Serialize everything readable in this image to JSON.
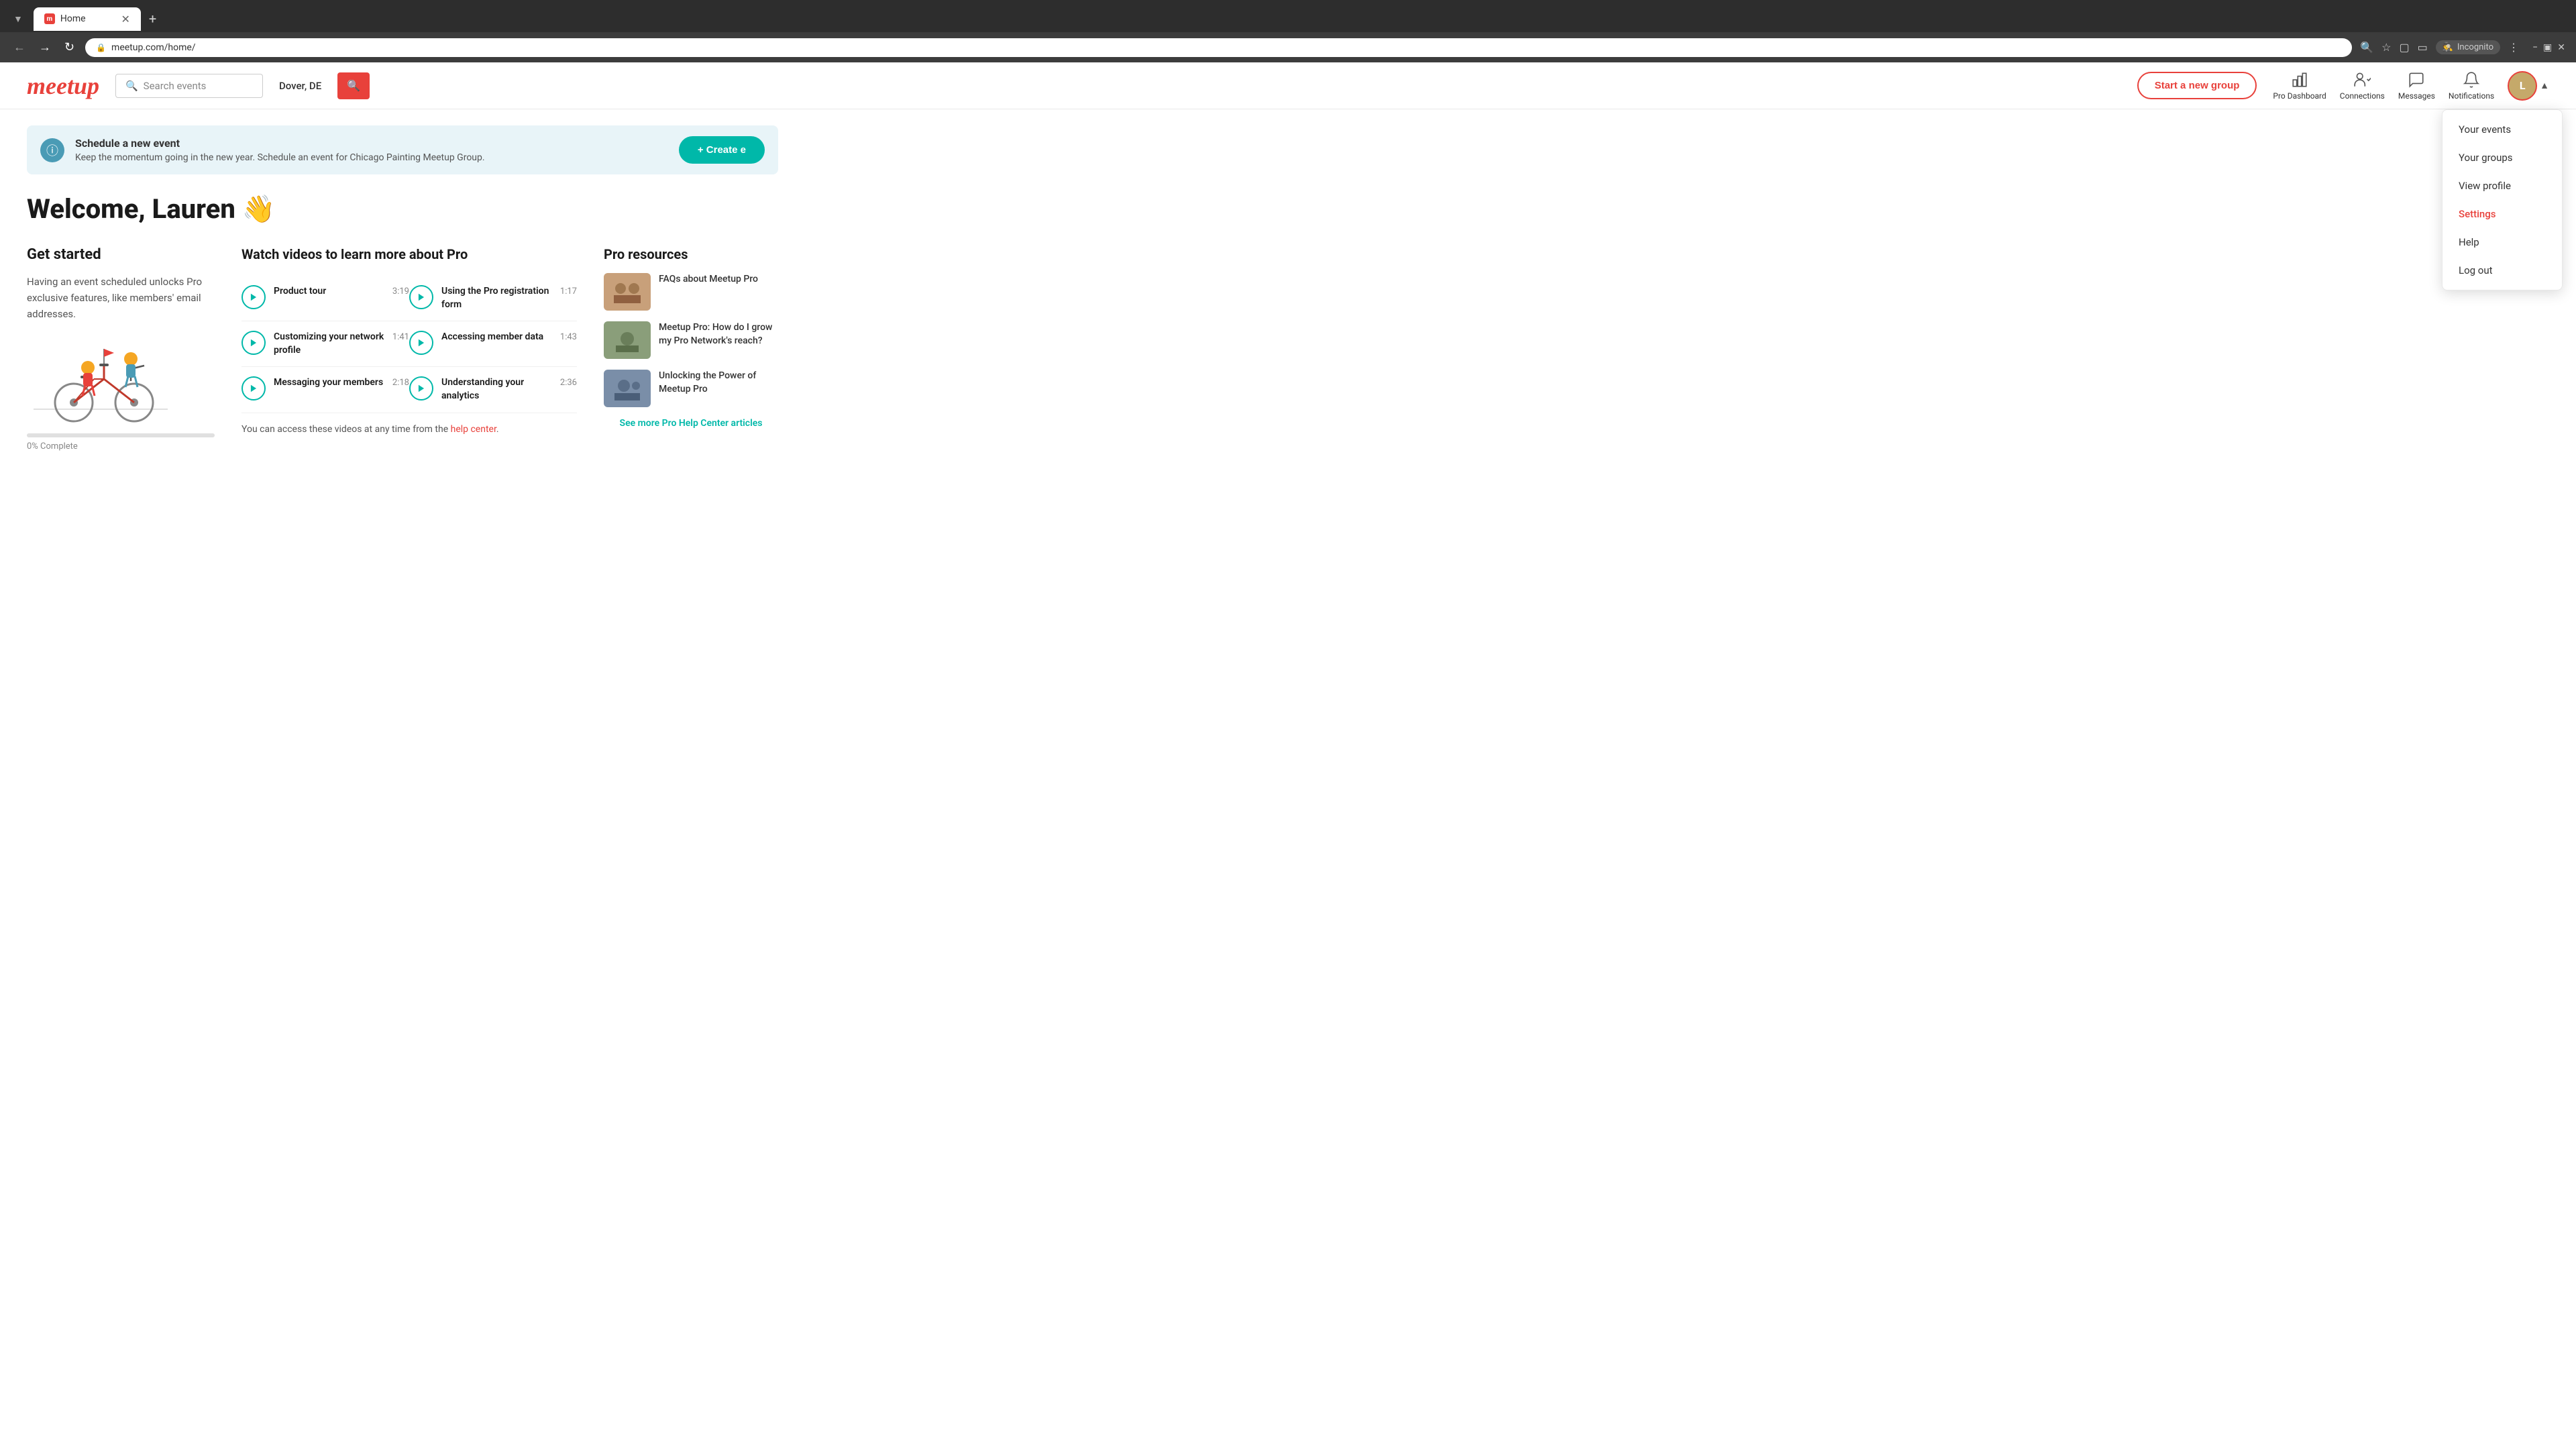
{
  "browser": {
    "tab_title": "Home",
    "tab_favicon": "m",
    "address": "meetup.com/home/",
    "incognito_label": "Incognito",
    "new_tab_label": "+"
  },
  "nav": {
    "logo": "meetup",
    "search_placeholder": "Search events",
    "location": "Dover, DE",
    "start_group_label": "Start a new group",
    "pro_dashboard_label": "Pro Dashboard",
    "connections_label": "Connections",
    "messages_label": "Messages",
    "notifications_label": "Notifications"
  },
  "dropdown": {
    "items": [
      {
        "label": "Your events",
        "active": false
      },
      {
        "label": "Your groups",
        "active": false
      },
      {
        "label": "View profile",
        "active": false
      },
      {
        "label": "Settings",
        "active": true
      },
      {
        "label": "Help",
        "active": false
      },
      {
        "label": "Log out",
        "active": false
      }
    ]
  },
  "banner": {
    "title": "Schedule a new event",
    "description": "Keep the momentum going in the new year. Schedule an event for Chicago Painting Meetup Group.",
    "create_button": "+ Create e"
  },
  "welcome": {
    "greeting": "Welcome, Lauren 👋"
  },
  "get_started": {
    "title": "Get started",
    "description": "Having an event scheduled unlocks Pro exclusive features, like members' email addresses.",
    "progress_label": "0% Complete",
    "progress_value": 0
  },
  "videos": {
    "title": "Watch videos to learn more about Pro",
    "items": [
      {
        "title": "Product tour",
        "duration": "3:19"
      },
      {
        "title": "Using the Pro registration form",
        "duration": "1:17"
      },
      {
        "title": "Customizing your network profile",
        "duration": "1:41"
      },
      {
        "title": "Accessing member data",
        "duration": "1:43"
      },
      {
        "title": "Messaging your members",
        "duration": "2:18"
      },
      {
        "title": "Understanding your analytics",
        "duration": "2:36"
      }
    ],
    "help_text": "You can access these videos at any time from the",
    "help_link_text": "help center",
    "help_text_end": "."
  },
  "pro_resources": {
    "title": "Pro resources",
    "items": [
      {
        "label": "FAQs about Meetup Pro",
        "thumb_color": "#c8a07a"
      },
      {
        "label": "Meetup Pro: How do I grow my Pro Network's reach?",
        "thumb_color": "#8a9e7a"
      },
      {
        "label": "Unlocking the Power of Meetup Pro",
        "thumb_color": "#7a8ea8"
      }
    ],
    "see_more_label": "See more Pro Help Center articles"
  },
  "colors": {
    "brand_red": "#e8413b",
    "brand_teal": "#00b8a9",
    "brand_blue": "#4a9bb5"
  }
}
